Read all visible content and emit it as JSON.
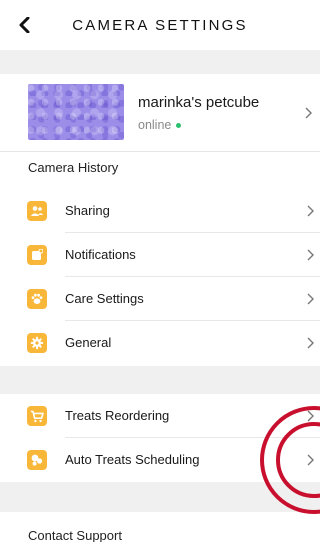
{
  "header": {
    "title": "CAMERA SETTINGS"
  },
  "camera": {
    "name": "marinka's petcube",
    "status": "online",
    "status_color": "#2fbf71"
  },
  "sections": {
    "history_label": "Camera History",
    "items": [
      {
        "label": "Sharing",
        "icon": "people-icon"
      },
      {
        "label": "Notifications",
        "icon": "notification-icon"
      },
      {
        "label": "Care Settings",
        "icon": "paw-icon"
      },
      {
        "label": "General",
        "icon": "gear-icon"
      }
    ],
    "treats": [
      {
        "label": "Treats Reordering",
        "icon": "cart-icon"
      },
      {
        "label": "Auto Treats Scheduling",
        "icon": "treat-icon"
      }
    ]
  },
  "support_label": "Contact Support",
  "colors": {
    "accent": "#f8b739",
    "highlight": "#c8102e",
    "band": "#f0f0f0"
  }
}
